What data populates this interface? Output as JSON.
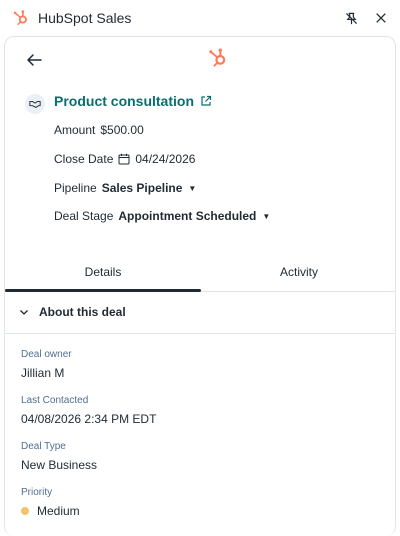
{
  "window": {
    "title": "HubSpot Sales",
    "icons": {
      "app": "hubspot-sprocket-icon",
      "pin": "unpin-icon",
      "close": "close-icon"
    }
  },
  "header": {
    "back_icon": "arrow-left-icon",
    "logo_icon": "hubspot-sprocket-icon"
  },
  "deal": {
    "icon": "handshake-icon",
    "name": "Product consultation",
    "link_icon": "external-link-icon",
    "amount_label": "Amount",
    "amount_value": "$500.00",
    "close_date_label": "Close Date",
    "close_date_value": "04/24/2026",
    "pipeline_label": "Pipeline",
    "pipeline_value": "Sales Pipeline",
    "stage_label": "Deal Stage",
    "stage_value": "Appointment Scheduled"
  },
  "tabs": [
    {
      "label": "Details",
      "active": true
    },
    {
      "label": "Activity",
      "active": false
    }
  ],
  "section": {
    "title": "About this deal",
    "fields": {
      "owner_label": "Deal owner",
      "owner_value": "Jillian M",
      "last_contacted_label": "Last Contacted",
      "last_contacted_value": "04/08/2026 2:34 PM EDT",
      "deal_type_label": "Deal Type",
      "deal_type_value": "New Business",
      "priority_label": "Priority",
      "priority_value": "Medium"
    }
  },
  "colors": {
    "accent_orange": "#ff7a59",
    "link_teal": "#0b6e6e",
    "priority_medium": "#f5c26b",
    "text": "#1f2a33",
    "muted": "#516f90",
    "border": "#dfe3eb"
  }
}
